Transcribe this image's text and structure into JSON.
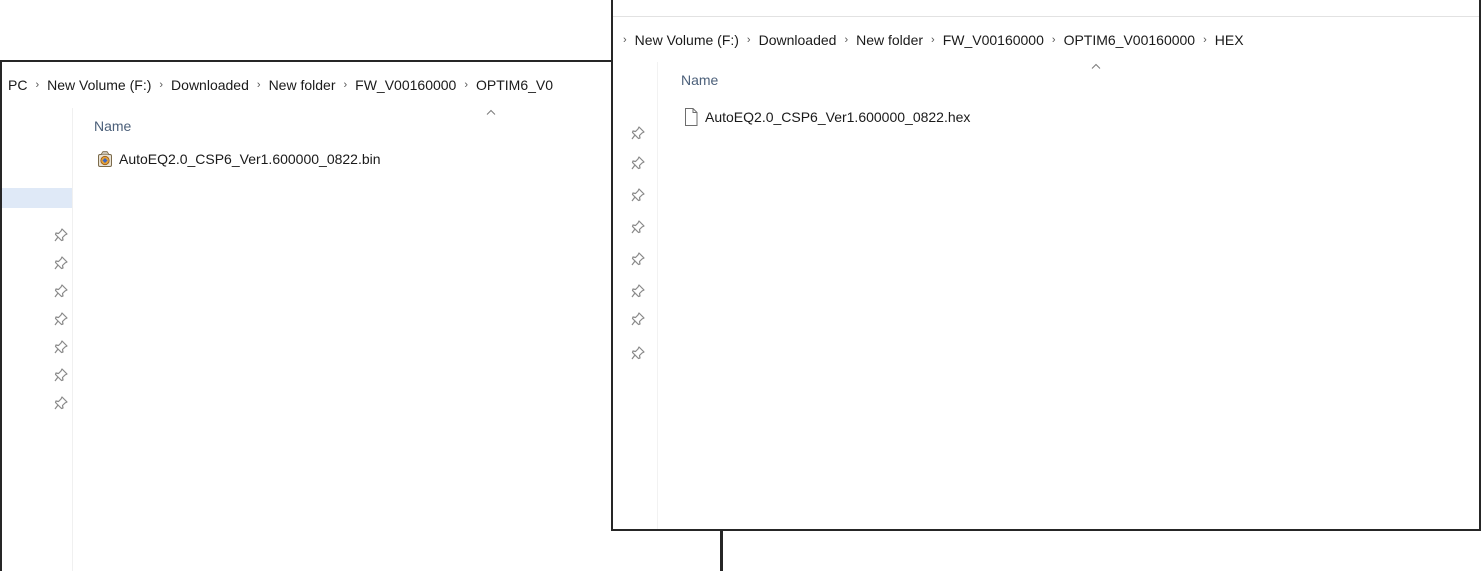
{
  "back_window": {
    "breadcrumb": [
      "PC",
      "New Volume (F:)",
      "Downloaded",
      "New folder",
      "FW_V00160000",
      "OPTIM6_V0"
    ],
    "column_header": "Name",
    "pinned_items": 7,
    "files": [
      {
        "name": "AutoEQ2.0_CSP6_Ver1.600000_0822.bin",
        "icon": "bin-file-icon"
      }
    ]
  },
  "front_window": {
    "breadcrumb": [
      "New Volume (F:)",
      "Downloaded",
      "New folder",
      "FW_V00160000",
      "OPTIM6_V00160000",
      "HEX"
    ],
    "column_header": "Name",
    "pinned_items": 8,
    "files": [
      {
        "name": "AutoEQ2.0_CSP6_Ver1.600000_0822.hex",
        "icon": "blank-file-icon"
      }
    ]
  },
  "colors": {
    "header_text": "#4c607a",
    "border": "#262626",
    "pin": "#8a8a8a",
    "selection": "#e5eefb"
  }
}
